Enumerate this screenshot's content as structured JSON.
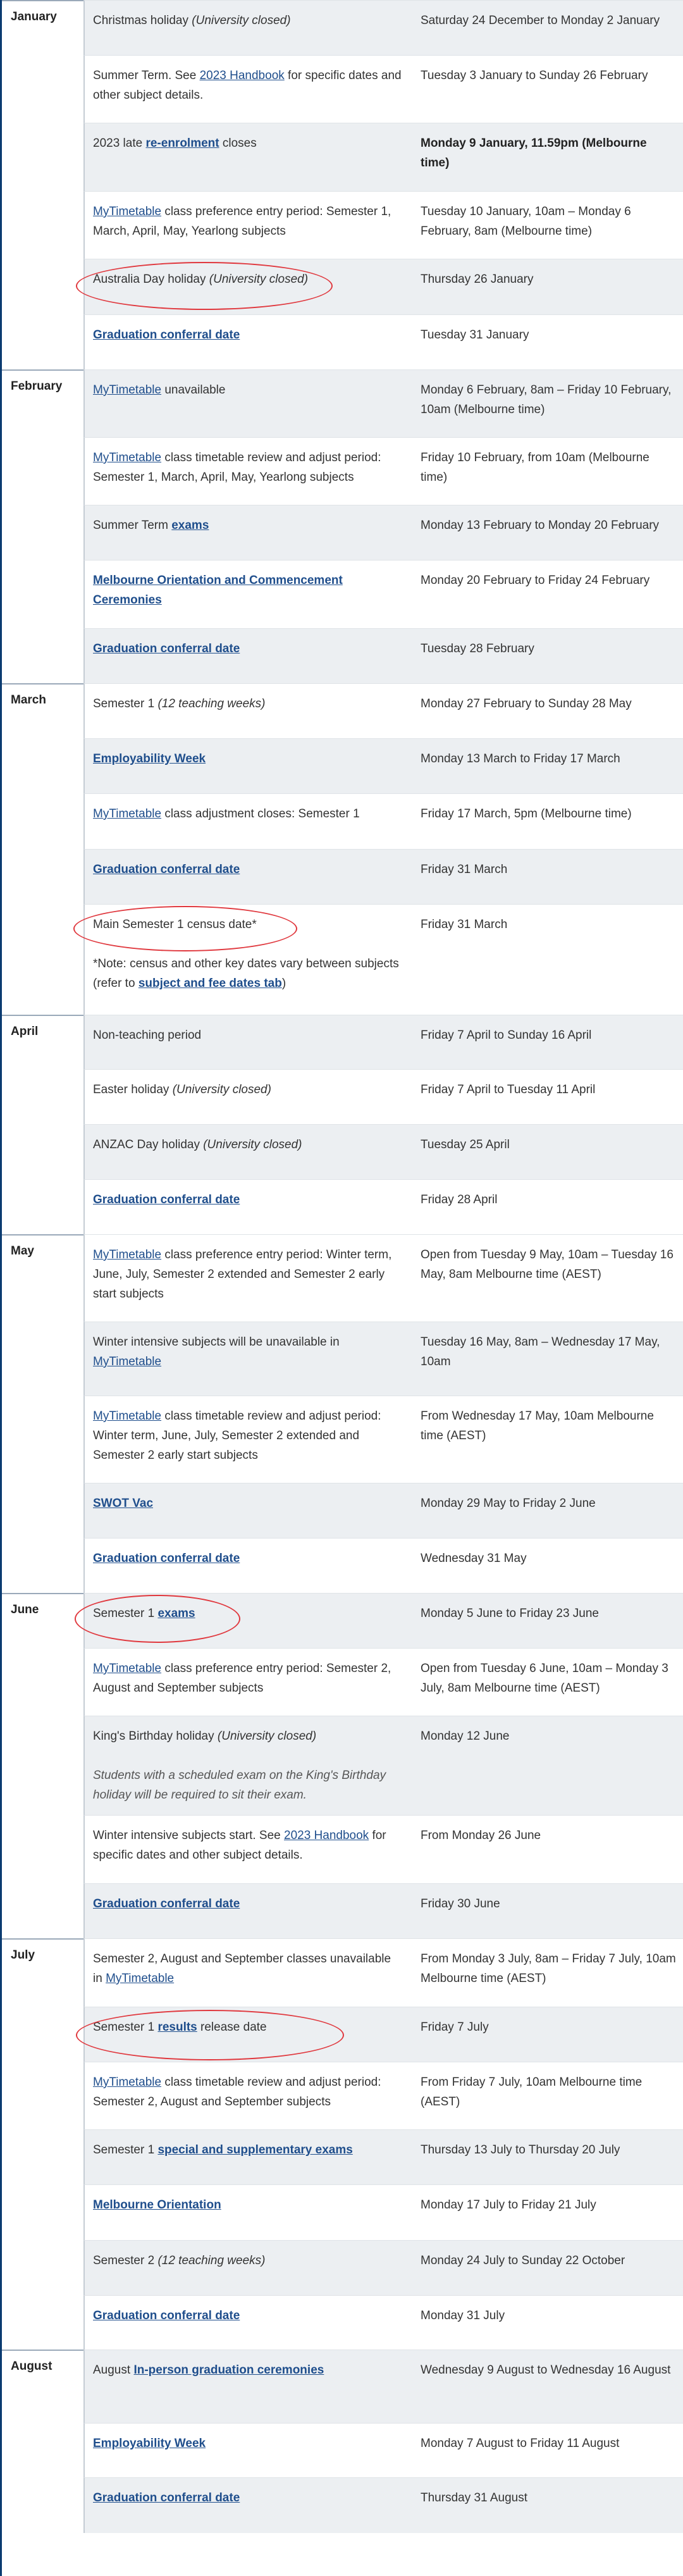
{
  "months": [
    {
      "id": "january",
      "label": "January",
      "rows": [
        {
          "desc": [
            {
              "t": "Christmas holiday "
            },
            {
              "t": "(University closed)",
              "s": "it"
            }
          ],
          "date": "Saturday 24 December to Monday 2 January"
        },
        {
          "desc": [
            {
              "t": "Summer Term. See "
            },
            {
              "t": "2023 Handbook",
              "s": "link"
            },
            {
              "t": " for specific dates and other subject details."
            }
          ],
          "date": "Tuesday 3 January to Sunday 26 February"
        },
        {
          "desc": [
            {
              "t": "2023 late "
            },
            {
              "t": "re-enrolment",
              "s": "link-bold"
            },
            {
              "t": " closes"
            }
          ],
          "date": "Monday 9 January, 11.59pm (Melbourne time)",
          "bold": true
        },
        {
          "desc": [
            {
              "t": "MyTimetable",
              "s": "link"
            },
            {
              "t": " class preference entry period: Semester 1, March, April, May, Yearlong subjects"
            }
          ],
          "date": "Tuesday 10 January, 10am – Monday 6 February, 8am (Melbourne time)"
        },
        {
          "desc": [
            {
              "t": "Australia Day holiday "
            },
            {
              "t": "(University closed)",
              "s": "it"
            }
          ],
          "date": "Thursday 26 January",
          "circled": true
        },
        {
          "desc": [
            {
              "t": "Graduation conferral date",
              "s": "link-bold"
            }
          ],
          "date": "Tuesday 31 January"
        }
      ]
    },
    {
      "id": "february",
      "label": "February",
      "rows": [
        {
          "desc": [
            {
              "t": "MyTimetable",
              "s": "link"
            },
            {
              "t": " unavailable"
            }
          ],
          "date": "Monday 6 February, 8am – Friday 10 February, 10am (Melbourne time)"
        },
        {
          "desc": [
            {
              "t": "MyTimetable",
              "s": "link"
            },
            {
              "t": " class timetable review and adjust period: Semester 1, March, April, May, Yearlong subjects"
            }
          ],
          "date": "Friday 10 February, from 10am (Melbourne time)"
        },
        {
          "desc": [
            {
              "t": "Summer Term "
            },
            {
              "t": "exams",
              "s": "link-bold"
            }
          ],
          "date": "Monday 13 February to Monday 20 February"
        },
        {
          "desc": [
            {
              "t": "Melbourne Orientation and Commencement Ceremonies",
              "s": "link-bold"
            }
          ],
          "date": "Monday 20 February to Friday 24 February"
        },
        {
          "desc": [
            {
              "t": "Graduation conferral date",
              "s": "link-bold"
            }
          ],
          "date": "Tuesday 28 February"
        }
      ]
    },
    {
      "id": "march",
      "label": "March",
      "rows": [
        {
          "desc": [
            {
              "t": "Semester 1 "
            },
            {
              "t": "(12 teaching weeks)",
              "s": "it"
            }
          ],
          "date": "Monday 27 February to Sunday 28 May"
        },
        {
          "desc": [
            {
              "t": "Employability Week",
              "s": "link-bold"
            }
          ],
          "date": "Monday 13 March to Friday 17 March"
        },
        {
          "desc": [
            {
              "t": "MyTimetable",
              "s": "link"
            },
            {
              "t": " class adjustment closes: Semester 1"
            }
          ],
          "date": "Friday 17 March, 5pm (Melbourne time)"
        },
        {
          "desc": [
            {
              "t": "Graduation conferral date",
              "s": "link-bold"
            }
          ],
          "date": "Friday 31 March"
        },
        {
          "desc": [
            {
              "t": "Main Semester 1 census date*"
            },
            {
              "br": true
            },
            {
              "br": true
            },
            {
              "t": "*Note: census and other key dates vary between subjects (refer to "
            },
            {
              "t": "subject and fee dates tab",
              "s": "link-bold"
            },
            {
              "t": ")"
            }
          ],
          "date": "Friday 31 March",
          "circled": true
        }
      ]
    },
    {
      "id": "april",
      "label": "April",
      "rows": [
        {
          "desc": [
            {
              "t": "Non-teaching period"
            }
          ],
          "date": "Friday 7 April to Sunday 16 April"
        },
        {
          "desc": [
            {
              "t": "Easter holiday "
            },
            {
              "t": "(University closed)",
              "s": "it"
            }
          ],
          "date": "Friday 7 April to Tuesday 11 April"
        },
        {
          "desc": [
            {
              "t": "ANZAC Day holiday "
            },
            {
              "t": "(University closed)",
              "s": "it"
            }
          ],
          "date": "Tuesday 25 April"
        },
        {
          "desc": [
            {
              "t": "Graduation conferral date",
              "s": "link-bold"
            }
          ],
          "date": "Friday 28 April"
        }
      ]
    },
    {
      "id": "may",
      "label": "May",
      "rows": [
        {
          "desc": [
            {
              "t": "MyTimetable",
              "s": "link"
            },
            {
              "t": " class preference entry period: Winter term, June, July, Semester 2 extended and Semester 2 early start subjects"
            }
          ],
          "date": "Open from Tuesday 9 May, 10am – Tuesday 16 May, 8am Melbourne time (AEST)"
        },
        {
          "desc": [
            {
              "t": "Winter intensive subjects will be unavailable in "
            },
            {
              "t": "MyTimetable",
              "s": "link"
            }
          ],
          "date": "Tuesday 16 May, 8am – Wednesday 17 May, 10am"
        },
        {
          "desc": [
            {
              "t": "MyTimetable",
              "s": "link"
            },
            {
              "t": " class timetable review and adjust period: Winter term, June, July, Semester 2 extended and Semester 2 early start subjects"
            }
          ],
          "date": "From Wednesday 17 May, 10am Melbourne time (AEST)"
        },
        {
          "desc": [
            {
              "t": "SWOT Vac",
              "s": "link-bold"
            }
          ],
          "date": "Monday 29 May to Friday 2 June"
        },
        {
          "desc": [
            {
              "t": "Graduation conferral date",
              "s": "link-bold"
            }
          ],
          "date": "Wednesday 31 May"
        }
      ]
    },
    {
      "id": "june",
      "label": "June",
      "rows": [
        {
          "desc": [
            {
              "t": "Semester 1 "
            },
            {
              "t": "exams",
              "s": "link-bold"
            }
          ],
          "date": "Monday 5 June to Friday 23 June",
          "circled": true
        },
        {
          "desc": [
            {
              "t": "MyTimetable",
              "s": "link"
            },
            {
              "t": " class preference entry period: Semester 2, August and September subjects"
            }
          ],
          "date": "Open from Tuesday 6 June, 10am – Monday 3 July, 8am Melbourne time (AEST)"
        },
        {
          "desc": [
            {
              "t": "King's Birthday holiday "
            },
            {
              "t": "(University closed)",
              "s": "it"
            },
            {
              "br": true
            },
            {
              "br": true
            },
            {
              "t": "Students with a scheduled exam on the King's Birthday holiday will be required to sit their exam.",
              "s": "note"
            }
          ],
          "date": "Monday 12 June"
        },
        {
          "desc": [
            {
              "t": "Winter intensive subjects start. See "
            },
            {
              "t": "2023 Handbook",
              "s": "link"
            },
            {
              "t": " for specific dates and other subject details."
            }
          ],
          "date": "From Monday 26 June"
        },
        {
          "desc": [
            {
              "t": "Graduation conferral date",
              "s": "link-bold"
            }
          ],
          "date": "Friday 30 June"
        }
      ]
    },
    {
      "id": "july",
      "label": "July",
      "rows": [
        {
          "desc": [
            {
              "t": "Semester 2, August and September classes unavailable in "
            },
            {
              "t": "MyTimetable",
              "s": "link"
            }
          ],
          "date": "From Monday 3 July, 8am – Friday 7 July, 10am Melbourne time (AEST)"
        },
        {
          "desc": [
            {
              "t": "Semester 1 "
            },
            {
              "t": "results",
              "s": "link-bold"
            },
            {
              "t": " release date"
            }
          ],
          "date": "Friday 7 July",
          "circled": true
        },
        {
          "desc": [
            {
              "t": "MyTimetable",
              "s": "link"
            },
            {
              "t": " class timetable review and adjust period: Semester 2, August and September subjects"
            }
          ],
          "date": "From Friday 7 July, 10am Melbourne time (AEST)"
        },
        {
          "desc": [
            {
              "t": "Semester 1 "
            },
            {
              "t": "special and supplementary exams",
              "s": "link-bold"
            }
          ],
          "date": "Thursday 13 July to Thursday 20 July"
        },
        {
          "desc": [
            {
              "t": "Melbourne Orientation",
              "s": "link-bold"
            }
          ],
          "date": "Monday 17 July to Friday 21 July"
        },
        {
          "desc": [
            {
              "t": "Semester 2 "
            },
            {
              "t": "(12 teaching weeks)",
              "s": "it"
            }
          ],
          "date": "Monday 24 July to Sunday 22 October"
        },
        {
          "desc": [
            {
              "t": "Graduation conferral date",
              "s": "link-bold"
            }
          ],
          "date": "Monday 31 July"
        }
      ]
    },
    {
      "id": "august",
      "label": "August",
      "rows": [
        {
          "desc": [
            {
              "t": "August "
            },
            {
              "t": "In-person graduation ceremonies",
              "s": "link-bold"
            }
          ],
          "date": "Wednesday 9 August to Wednesday 16 August"
        },
        {
          "desc": [
            {
              "t": "Employability Week",
              "s": "link-bold"
            }
          ],
          "date": "Monday 7 August to Friday 11 August"
        },
        {
          "desc": [
            {
              "t": "Graduation conferral date",
              "s": "link-bold"
            }
          ],
          "date": "Thursday 31 August"
        }
      ]
    }
  ]
}
